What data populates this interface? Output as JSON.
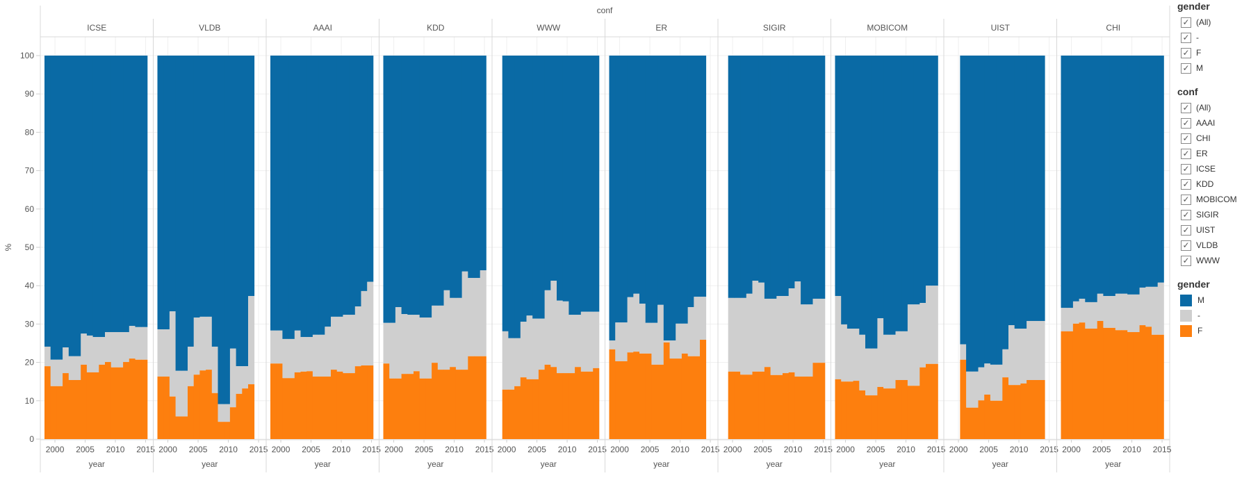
{
  "chart_data": {
    "type": "area",
    "subtype": "stacked-percent-step",
    "title": "",
    "facet_label": "conf",
    "xlabel": "year",
    "ylabel": "%",
    "ylim": [
      0,
      100
    ],
    "yticks": [
      0,
      10,
      20,
      30,
      40,
      50,
      60,
      70,
      80,
      90,
      100
    ],
    "xticks": [
      2000,
      2005,
      2010,
      2015
    ],
    "grid": true,
    "legend_placement": "right",
    "colors": {
      "M": "#0a6aa5",
      "-": "#cfcfcf",
      "F": "#fd7f0e"
    },
    "stack_order": [
      "F",
      "-",
      "M"
    ],
    "panels": [
      {
        "conf": "ICSE",
        "start_year": 1999,
        "F": [
          19.0,
          13.8,
          13.8,
          17.2,
          15.4,
          15.4,
          19.4,
          17.4,
          17.4,
          19.4,
          20.1,
          18.7,
          18.7,
          20.1,
          21.0,
          20.7,
          20.7
        ],
        "dash": [
          5.1,
          6.9,
          6.9,
          6.7,
          6.2,
          6.2,
          8.1,
          9.6,
          9.2,
          7.2,
          7.8,
          9.2,
          9.2,
          7.8,
          8.5,
          8.5,
          8.5
        ],
        "M": [
          75.9,
          79.3,
          79.3,
          76.1,
          78.4,
          78.4,
          72.5,
          73.0,
          73.4,
          73.4,
          72.1,
          72.1,
          72.1,
          72.1,
          70.5,
          70.8,
          70.8
        ]
      },
      {
        "conf": "VLDB",
        "start_year": 1999,
        "F": [
          16.3,
          16.3,
          11.1,
          5.9,
          5.9,
          13.8,
          16.8,
          17.9,
          18.1,
          12.0,
          4.5,
          4.5,
          8.3,
          11.8,
          13.2,
          14.3
        ],
        "dash": [
          12.3,
          12.3,
          22.2,
          11.9,
          11.9,
          10.3,
          14.9,
          14.0,
          13.8,
          12.1,
          4.6,
          4.6,
          15.3,
          7.2,
          5.8,
          23.0
        ],
        "M": [
          71.4,
          71.4,
          66.7,
          82.2,
          82.2,
          75.9,
          68.3,
          68.1,
          68.1,
          75.9,
          90.9,
          90.9,
          76.4,
          81.0,
          81.0,
          62.7
        ]
      },
      {
        "conf": "AAAI",
        "start_year": 1999,
        "F": [
          19.7,
          19.7,
          15.9,
          15.9,
          17.4,
          17.6,
          17.7,
          16.3,
          16.3,
          16.3,
          18.1,
          17.6,
          17.2,
          17.2,
          19.0,
          19.2,
          19.2
        ],
        "dash": [
          8.6,
          8.6,
          10.2,
          10.2,
          10.9,
          9.0,
          8.9,
          10.9,
          10.9,
          13.0,
          13.8,
          14.3,
          15.2,
          15.2,
          15.6,
          19.4,
          21.8
        ],
        "M": [
          71.7,
          71.7,
          73.9,
          73.9,
          71.7,
          73.4,
          73.4,
          72.8,
          72.8,
          70.7,
          68.1,
          68.1,
          67.6,
          67.6,
          65.4,
          61.4,
          59.0
        ]
      },
      {
        "conf": "KDD",
        "start_year": 1999,
        "F": [
          19.7,
          15.8,
          15.8,
          17.0,
          17.0,
          17.7,
          15.8,
          15.8,
          19.9,
          18.1,
          18.1,
          18.8,
          18.1,
          18.1,
          21.6,
          21.6,
          21.6
        ],
        "dash": [
          10.6,
          14.5,
          18.6,
          15.6,
          15.4,
          14.7,
          15.9,
          15.9,
          14.9,
          16.7,
          20.7,
          18.0,
          18.7,
          25.6,
          20.4,
          20.4,
          22.4
        ],
        "M": [
          69.7,
          69.7,
          65.6,
          67.4,
          67.6,
          67.6,
          68.3,
          68.3,
          65.2,
          65.2,
          61.2,
          63.2,
          63.2,
          56.3,
          58.0,
          58.0,
          56.0
        ]
      },
      {
        "conf": "WWW",
        "start_year": 2000,
        "F": [
          12.9,
          12.9,
          13.8,
          16.1,
          15.6,
          15.6,
          18.1,
          19.4,
          18.8,
          17.2,
          17.2,
          17.2,
          18.8,
          17.6,
          17.6,
          18.5
        ],
        "dash": [
          15.2,
          13.4,
          12.5,
          14.5,
          16.6,
          15.8,
          13.3,
          19.4,
          22.5,
          18.9,
          18.7,
          15.2,
          13.6,
          15.6,
          15.6,
          14.7
        ],
        "M": [
          71.9,
          73.7,
          73.7,
          69.4,
          67.8,
          68.6,
          68.6,
          61.2,
          58.7,
          63.9,
          64.1,
          67.6,
          67.6,
          66.8,
          66.8,
          66.8
        ]
      },
      {
        "conf": "ER",
        "start_year": 1999,
        "F": [
          23.4,
          20.3,
          20.3,
          22.6,
          22.8,
          22.3,
          22.3,
          19.4,
          19.4,
          25.2,
          21.0,
          21.0,
          22.3,
          21.6,
          21.6,
          25.9
        ],
        "dash": [
          2.3,
          10.1,
          10.1,
          14.4,
          15.1,
          13.0,
          8.0,
          10.9,
          15.6,
          0.5,
          4.7,
          9.1,
          7.8,
          12.8,
          15.5,
          11.2
        ],
        "M": [
          74.3,
          69.6,
          69.6,
          63.0,
          62.1,
          64.7,
          69.7,
          69.7,
          65.0,
          74.3,
          74.3,
          69.9,
          69.9,
          65.6,
          62.9,
          62.9
        ]
      },
      {
        "conf": "SIGIR",
        "start_year": 2000,
        "F": [
          17.6,
          17.6,
          16.8,
          16.8,
          17.6,
          17.6,
          18.8,
          16.7,
          16.7,
          17.2,
          17.4,
          16.3,
          16.3,
          16.3,
          19.9,
          19.9
        ],
        "dash": [
          19.2,
          19.2,
          20.0,
          21.1,
          23.7,
          23.2,
          17.8,
          19.9,
          20.6,
          20.1,
          21.9,
          24.8,
          18.8,
          18.8,
          16.7,
          16.7
        ],
        "M": [
          63.2,
          63.2,
          63.2,
          62.1,
          58.7,
          59.2,
          63.4,
          63.4,
          62.7,
          62.7,
          60.7,
          58.9,
          64.9,
          64.9,
          63.4,
          63.4
        ]
      },
      {
        "conf": "MOBICOM",
        "start_year": 1999,
        "F": [
          15.6,
          15.0,
          15.0,
          15.2,
          12.7,
          11.4,
          11.4,
          13.6,
          13.2,
          13.2,
          15.4,
          15.4,
          13.9,
          13.9,
          18.7,
          19.6,
          19.6
        ],
        "dash": [
          21.7,
          14.9,
          13.8,
          13.6,
          14.5,
          12.2,
          12.2,
          17.9,
          14.0,
          14.0,
          12.7,
          12.7,
          21.2,
          21.2,
          16.8,
          20.4,
          20.4
        ],
        "M": [
          62.7,
          70.1,
          71.2,
          71.2,
          72.8,
          76.4,
          76.4,
          68.5,
          72.8,
          72.8,
          71.9,
          71.9,
          64.9,
          64.9,
          64.5,
          60.0,
          60.0
        ]
      },
      {
        "conf": "UIST",
        "start_year": 2001,
        "F": [
          20.7,
          8.2,
          8.2,
          10.1,
          11.6,
          10.0,
          10.0,
          16.1,
          14.1,
          14.1,
          14.5,
          15.4,
          15.4,
          15.4
        ],
        "dash": [
          4.0,
          9.4,
          9.4,
          8.6,
          8.1,
          9.4,
          9.4,
          7.3,
          15.6,
          14.7,
          14.3,
          15.4,
          15.4,
          15.4
        ],
        "M": [
          75.3,
          82.4,
          82.4,
          81.3,
          80.3,
          80.6,
          80.6,
          76.6,
          70.3,
          71.2,
          71.2,
          69.2,
          69.2,
          69.2
        ]
      },
      {
        "conf": "CHI",
        "start_year": 1999,
        "F": [
          28.1,
          28.1,
          30.1,
          30.4,
          28.8,
          28.8,
          30.8,
          29.0,
          29.0,
          28.4,
          28.4,
          27.9,
          27.9,
          29.7,
          29.3,
          27.2,
          27.2
        ],
        "dash": [
          6.1,
          6.1,
          5.8,
          6.2,
          6.9,
          6.9,
          7.1,
          8.3,
          8.3,
          9.5,
          9.5,
          9.8,
          9.8,
          9.8,
          10.4,
          12.5,
          13.6
        ],
        "M": [
          65.8,
          65.8,
          64.1,
          63.4,
          64.3,
          64.3,
          62.1,
          62.7,
          62.7,
          62.1,
          62.1,
          62.3,
          62.3,
          60.5,
          60.3,
          60.3,
          59.2
        ]
      }
    ]
  },
  "legend": {
    "gender_filter": {
      "title": "gender",
      "items": [
        "(All)",
        "-",
        "F",
        "M"
      ]
    },
    "conf_filter": {
      "title": "conf",
      "items": [
        "(All)",
        "AAAI",
        "CHI",
        "ER",
        "ICSE",
        "KDD",
        "MOBICOM",
        "SIGIR",
        "UIST",
        "VLDB",
        "WWW"
      ]
    },
    "gender_colors": {
      "title": "gender",
      "items": [
        {
          "label": "M",
          "color": "#0a6aa5"
        },
        {
          "label": "-",
          "color": "#cfcfcf"
        },
        {
          "label": "F",
          "color": "#fd7f0e"
        }
      ]
    },
    "check_glyph": "✓"
  }
}
